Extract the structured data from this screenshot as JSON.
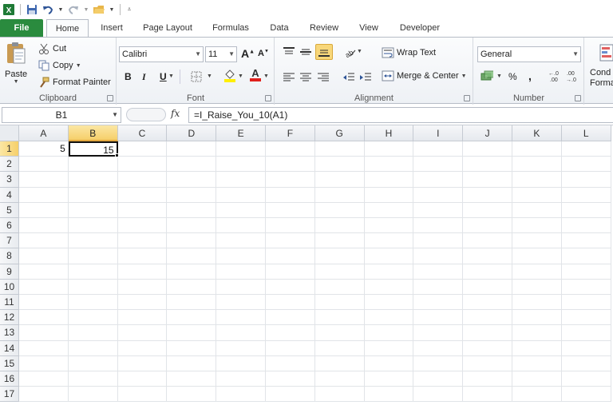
{
  "app": {
    "title": "Microsoft Excel"
  },
  "tabs": [
    {
      "label": "File",
      "active": false
    },
    {
      "label": "Home",
      "active": true
    },
    {
      "label": "Insert"
    },
    {
      "label": "Page Layout"
    },
    {
      "label": "Formulas"
    },
    {
      "label": "Data"
    },
    {
      "label": "Review"
    },
    {
      "label": "View"
    },
    {
      "label": "Developer"
    }
  ],
  "clipboard": {
    "paste": "Paste",
    "cut": "Cut",
    "copy": "Copy",
    "format_painter": "Format Painter",
    "label": "Clipboard"
  },
  "font": {
    "name": "Calibri",
    "size": "11",
    "bold": "B",
    "italic": "I",
    "underline": "U",
    "label": "Font"
  },
  "alignment": {
    "wrap_text": "Wrap Text",
    "merge_center": "Merge & Center",
    "label": "Alignment"
  },
  "number": {
    "format": "General",
    "percent": "%",
    "comma": ",",
    "label": "Number"
  },
  "styles": {
    "conditional_line1": "Cond",
    "conditional_line2": "Forma"
  },
  "formula_bar": {
    "name_box": "B1",
    "fx": "fx",
    "formula": "=I_Raise_You_10(A1)"
  },
  "columns": [
    "A",
    "B",
    "C",
    "D",
    "E",
    "F",
    "G",
    "H",
    "I",
    "J",
    "K",
    "L"
  ],
  "rows": [
    "1",
    "2",
    "3",
    "4",
    "5",
    "6",
    "7",
    "8",
    "9",
    "10",
    "11",
    "12",
    "13",
    "14",
    "15",
    "16",
    "17"
  ],
  "cells": {
    "A1": "5",
    "B1": "15"
  },
  "selection": {
    "cell": "B1",
    "column": "B",
    "row": "1"
  },
  "colors": {
    "file_tab": "#2a8b3e",
    "selected_header": "#f6cf6a",
    "highlight_button": "#f8d77a"
  }
}
